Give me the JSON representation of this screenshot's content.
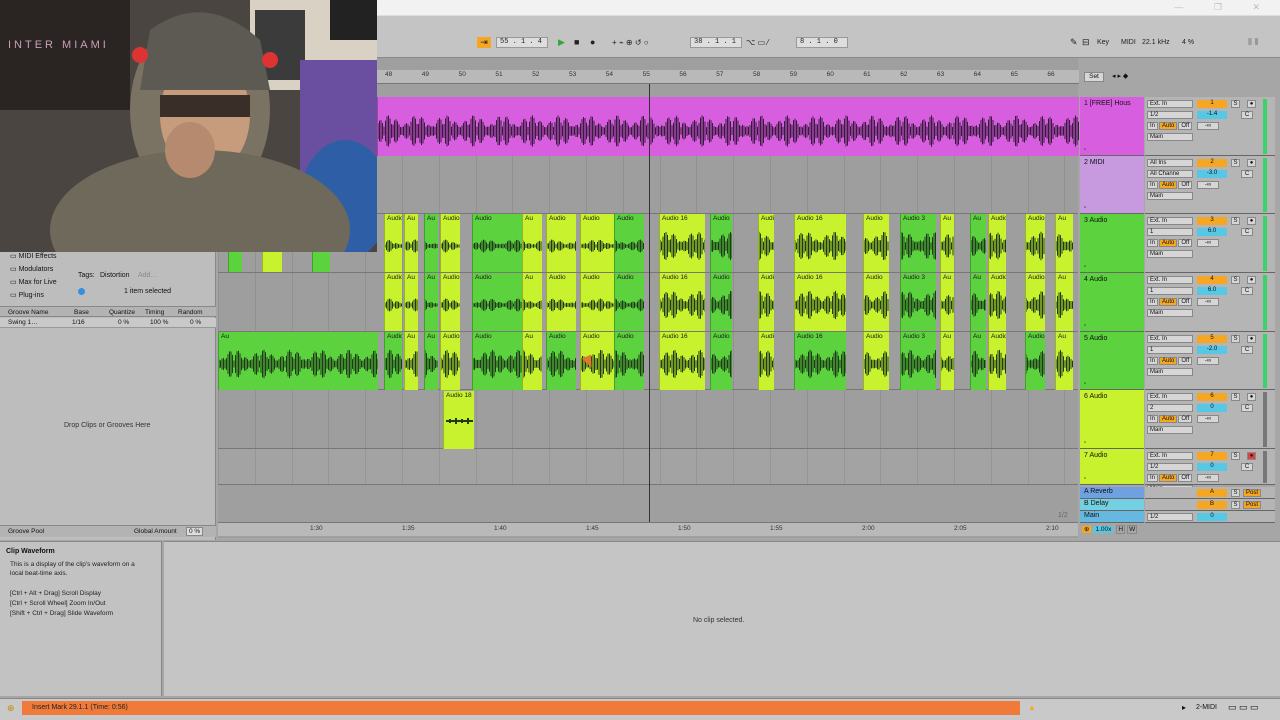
{
  "colors": {
    "pink": "#d85ee0",
    "purple_light": "#c79ae0",
    "green": "#5cd23e",
    "lime": "#c9f22e",
    "orange": "#f5a623",
    "cyan": "#56c8e6",
    "status_orange": "#f07a3a"
  },
  "control_bar": {
    "position": "55 . 1 . 4",
    "tempo_pos": "38 . 1 . 1",
    "loop_len": "8 . 1 . 0",
    "key_label": "Key",
    "midi_label": "MIDI",
    "sample_rate": "22.1 kHz",
    "cpu": "4 %"
  },
  "browser": {
    "items": [
      "MIDI Effects",
      "Modulators",
      "Max for Live",
      "Plug-ins"
    ],
    "tags_label": "Tags:",
    "tag_value": "Distortion",
    "tag_add": "Add...",
    "selected_info": "1 item selected",
    "groove_cols": [
      "Groove Name",
      "Base",
      "Quantize",
      "Timing",
      "Random"
    ],
    "groove_row": {
      "name": "Swing 1…",
      "base": "1/16",
      "quantize": "0 %",
      "timing": "100 %",
      "random": "0 %"
    },
    "drop_text": "Drop Clips or Grooves Here",
    "groove_pool": "Groove Pool",
    "global_amount_label": "Global Amount",
    "global_amount_value": "0 %"
  },
  "ruler_bars": [
    "48",
    "49",
    "50",
    "51",
    "52",
    "53",
    "54",
    "55",
    "56",
    "57",
    "58",
    "59",
    "60",
    "61",
    "62",
    "63",
    "64",
    "65",
    "66"
  ],
  "time_ticks": [
    "1:30",
    "1:35",
    "1:40",
    "1:45",
    "1:50",
    "1:55",
    "2:00",
    "2:05",
    "2:10"
  ],
  "set_label": "Set",
  "page_indicator": "1/2",
  "tracks": [
    {
      "name": "1 [FREE] Hous",
      "input": "Ext. In",
      "ch": "1/2",
      "out": "Main",
      "num": "1",
      "vol": "-1.4",
      "pan": "C"
    },
    {
      "name": "2 MIDI",
      "input": "All Ins",
      "ch": "All Channe",
      "out": "Main",
      "num": "2",
      "vol": "-3.0",
      "pan": "C"
    },
    {
      "name": "3 Audio",
      "input": "Ext. In",
      "ch": "1",
      "out": "Main",
      "num": "3",
      "vol": "6.0",
      "pan": "C"
    },
    {
      "name": "4 Audio",
      "input": "Ext. In",
      "ch": "1",
      "out": "Main",
      "num": "4",
      "vol": "6.0",
      "pan": "C"
    },
    {
      "name": "5 Audio",
      "input": "Ext. In",
      "ch": "1",
      "out": "Main",
      "num": "5",
      "vol": "-2.0",
      "pan": "C"
    },
    {
      "name": "6 Audio",
      "input": "Ext. In",
      "ch": "2",
      "out": "Main",
      "num": "6",
      "vol": "0",
      "pan": "C"
    },
    {
      "name": "7 Audio",
      "input": "Ext. In",
      "ch": "1/2",
      "out": "Main",
      "num": "7",
      "vol": "0",
      "pan": "C"
    }
  ],
  "returns": [
    {
      "name": "A Reverb",
      "letter": "A",
      "post": "Post"
    },
    {
      "name": "B Delay",
      "letter": "B",
      "post": "Post"
    },
    {
      "name": "Main",
      "ch": "1/2",
      "vol": "0"
    }
  ],
  "io_labels": {
    "in": "In",
    "auto": "Auto",
    "off": "Off",
    "s": "S",
    "c": "C",
    "neg_inf": "-∞",
    "h": "H",
    "w": "W",
    "zoom": "1.00x"
  },
  "clip_labels": {
    "audio16": "Audio 16",
    "audio3": "Audio 3",
    "audio18": "Audio 18",
    "audio": "Audio",
    "au": "Au"
  },
  "info": {
    "title": "Clip Waveform",
    "lines": [
      "This is a display of the clip's waveform on a",
      "local beat-time axis.",
      "",
      "[Ctrl + Alt + Drag] Scroll Display",
      "[Ctrl + Scroll Wheel] Zoom In/Out",
      "[Shift + Ctrl + Drag] Slide Waveform"
    ]
  },
  "detail_empty": "No clip selected.",
  "status": {
    "text": "Insert Mark 29.1.1 (Time: 0:56)",
    "track": "2-MIDI"
  }
}
